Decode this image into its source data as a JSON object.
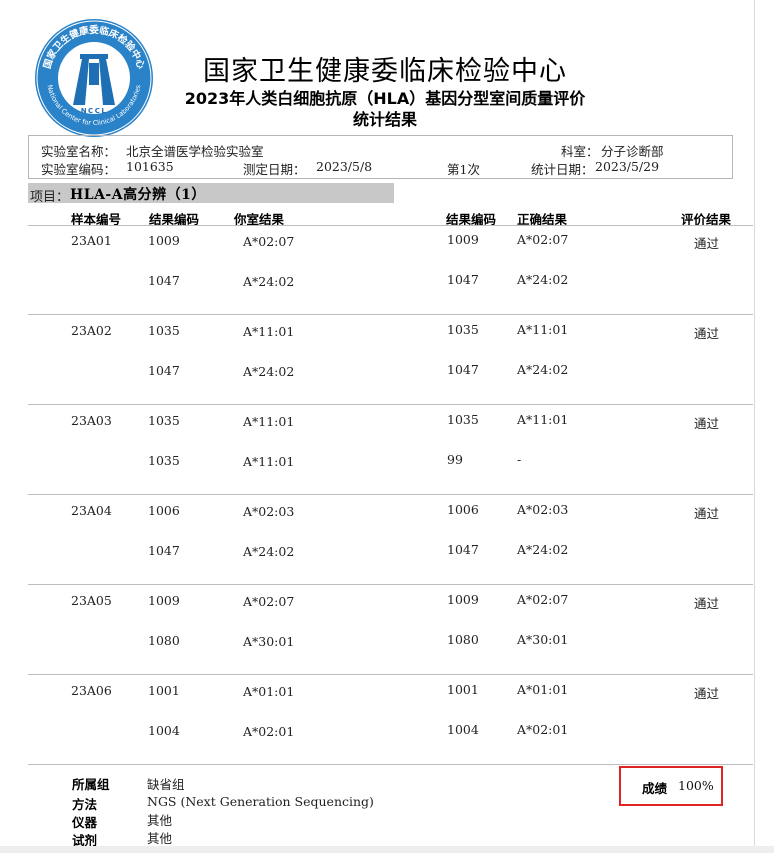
{
  "header": {
    "org_name": "国家卫生健康委临床检验中心",
    "report_title": "2023年人类白细胞抗原（HLA）基因分型室间质量评价",
    "report_subtitle": "统计结果",
    "logo": {
      "icon": "nccl-seal-icon",
      "ring_text": "国家卫生健康委临床检验中心",
      "english_text": "National Center for Clinical Laboratories",
      "abbr": "NCCL",
      "colors": {
        "blue": "#1f6fb5",
        "ring": "#2a82c8"
      }
    }
  },
  "lab_info": {
    "lab_name_label": "实验室名称：",
    "lab_name": "北京全谱医学检验实验室",
    "department_label": "科室：",
    "department": "分子诊断部",
    "lab_code_label": "实验室编码：",
    "lab_code": "101635",
    "test_date_label": "测定日期：",
    "test_date": "2023/5/8",
    "round": "第1次",
    "stat_date_label": "统计日期：",
    "stat_date": "2023/5/29"
  },
  "item": {
    "label": "项目：",
    "value": "HLA-A高分辨（1）"
  },
  "columns": {
    "sample_id": "样本编号",
    "result_code": "结果编码",
    "your_result": "你室结果",
    "result_code_2": "结果编码",
    "correct_result": "正确结果",
    "evaluation": "评价结果"
  },
  "samples": [
    {
      "id": "23A01",
      "evaluation": "通过",
      "alleles": [
        {
          "your_code": "1009",
          "your_result": "A*02:07",
          "correct_code": "1009",
          "correct_result": "A*02:07"
        },
        {
          "your_code": "1047",
          "your_result": "A*24:02",
          "correct_code": "1047",
          "correct_result": "A*24:02"
        }
      ]
    },
    {
      "id": "23A02",
      "evaluation": "通过",
      "alleles": [
        {
          "your_code": "1035",
          "your_result": "A*11:01",
          "correct_code": "1035",
          "correct_result": "A*11:01"
        },
        {
          "your_code": "1047",
          "your_result": "A*24:02",
          "correct_code": "1047",
          "correct_result": "A*24:02"
        }
      ]
    },
    {
      "id": "23A03",
      "evaluation": "通过",
      "alleles": [
        {
          "your_code": "1035",
          "your_result": "A*11:01",
          "correct_code": "1035",
          "correct_result": "A*11:01"
        },
        {
          "your_code": "1035",
          "your_result": "A*11:01",
          "correct_code": "99",
          "correct_result": "-"
        }
      ]
    },
    {
      "id": "23A04",
      "evaluation": "通过",
      "alleles": [
        {
          "your_code": "1006",
          "your_result": "A*02:03",
          "correct_code": "1006",
          "correct_result": "A*02:03"
        },
        {
          "your_code": "1047",
          "your_result": "A*24:02",
          "correct_code": "1047",
          "correct_result": "A*24:02"
        }
      ]
    },
    {
      "id": "23A05",
      "evaluation": "通过",
      "alleles": [
        {
          "your_code": "1009",
          "your_result": "A*02:07",
          "correct_code": "1009",
          "correct_result": "A*02:07"
        },
        {
          "your_code": "1080",
          "your_result": "A*30:01",
          "correct_code": "1080",
          "correct_result": "A*30:01"
        }
      ]
    },
    {
      "id": "23A06",
      "evaluation": "通过",
      "alleles": [
        {
          "your_code": "1001",
          "your_result": "A*01:01",
          "correct_code": "1001",
          "correct_result": "A*01:01"
        },
        {
          "your_code": "1004",
          "your_result": "A*02:01",
          "correct_code": "1004",
          "correct_result": "A*02:01"
        }
      ]
    }
  ],
  "footer": {
    "group_label": "所属组",
    "group": "缺省组",
    "method_label": "方法",
    "method": "NGS (Next Generation Sequencing)",
    "instrument_label": "仪器",
    "instrument": "其他",
    "reagent_label": "试剂",
    "reagent": "其他",
    "score_label": "成绩",
    "score": "100%",
    "highlight_color": "#e02424"
  }
}
